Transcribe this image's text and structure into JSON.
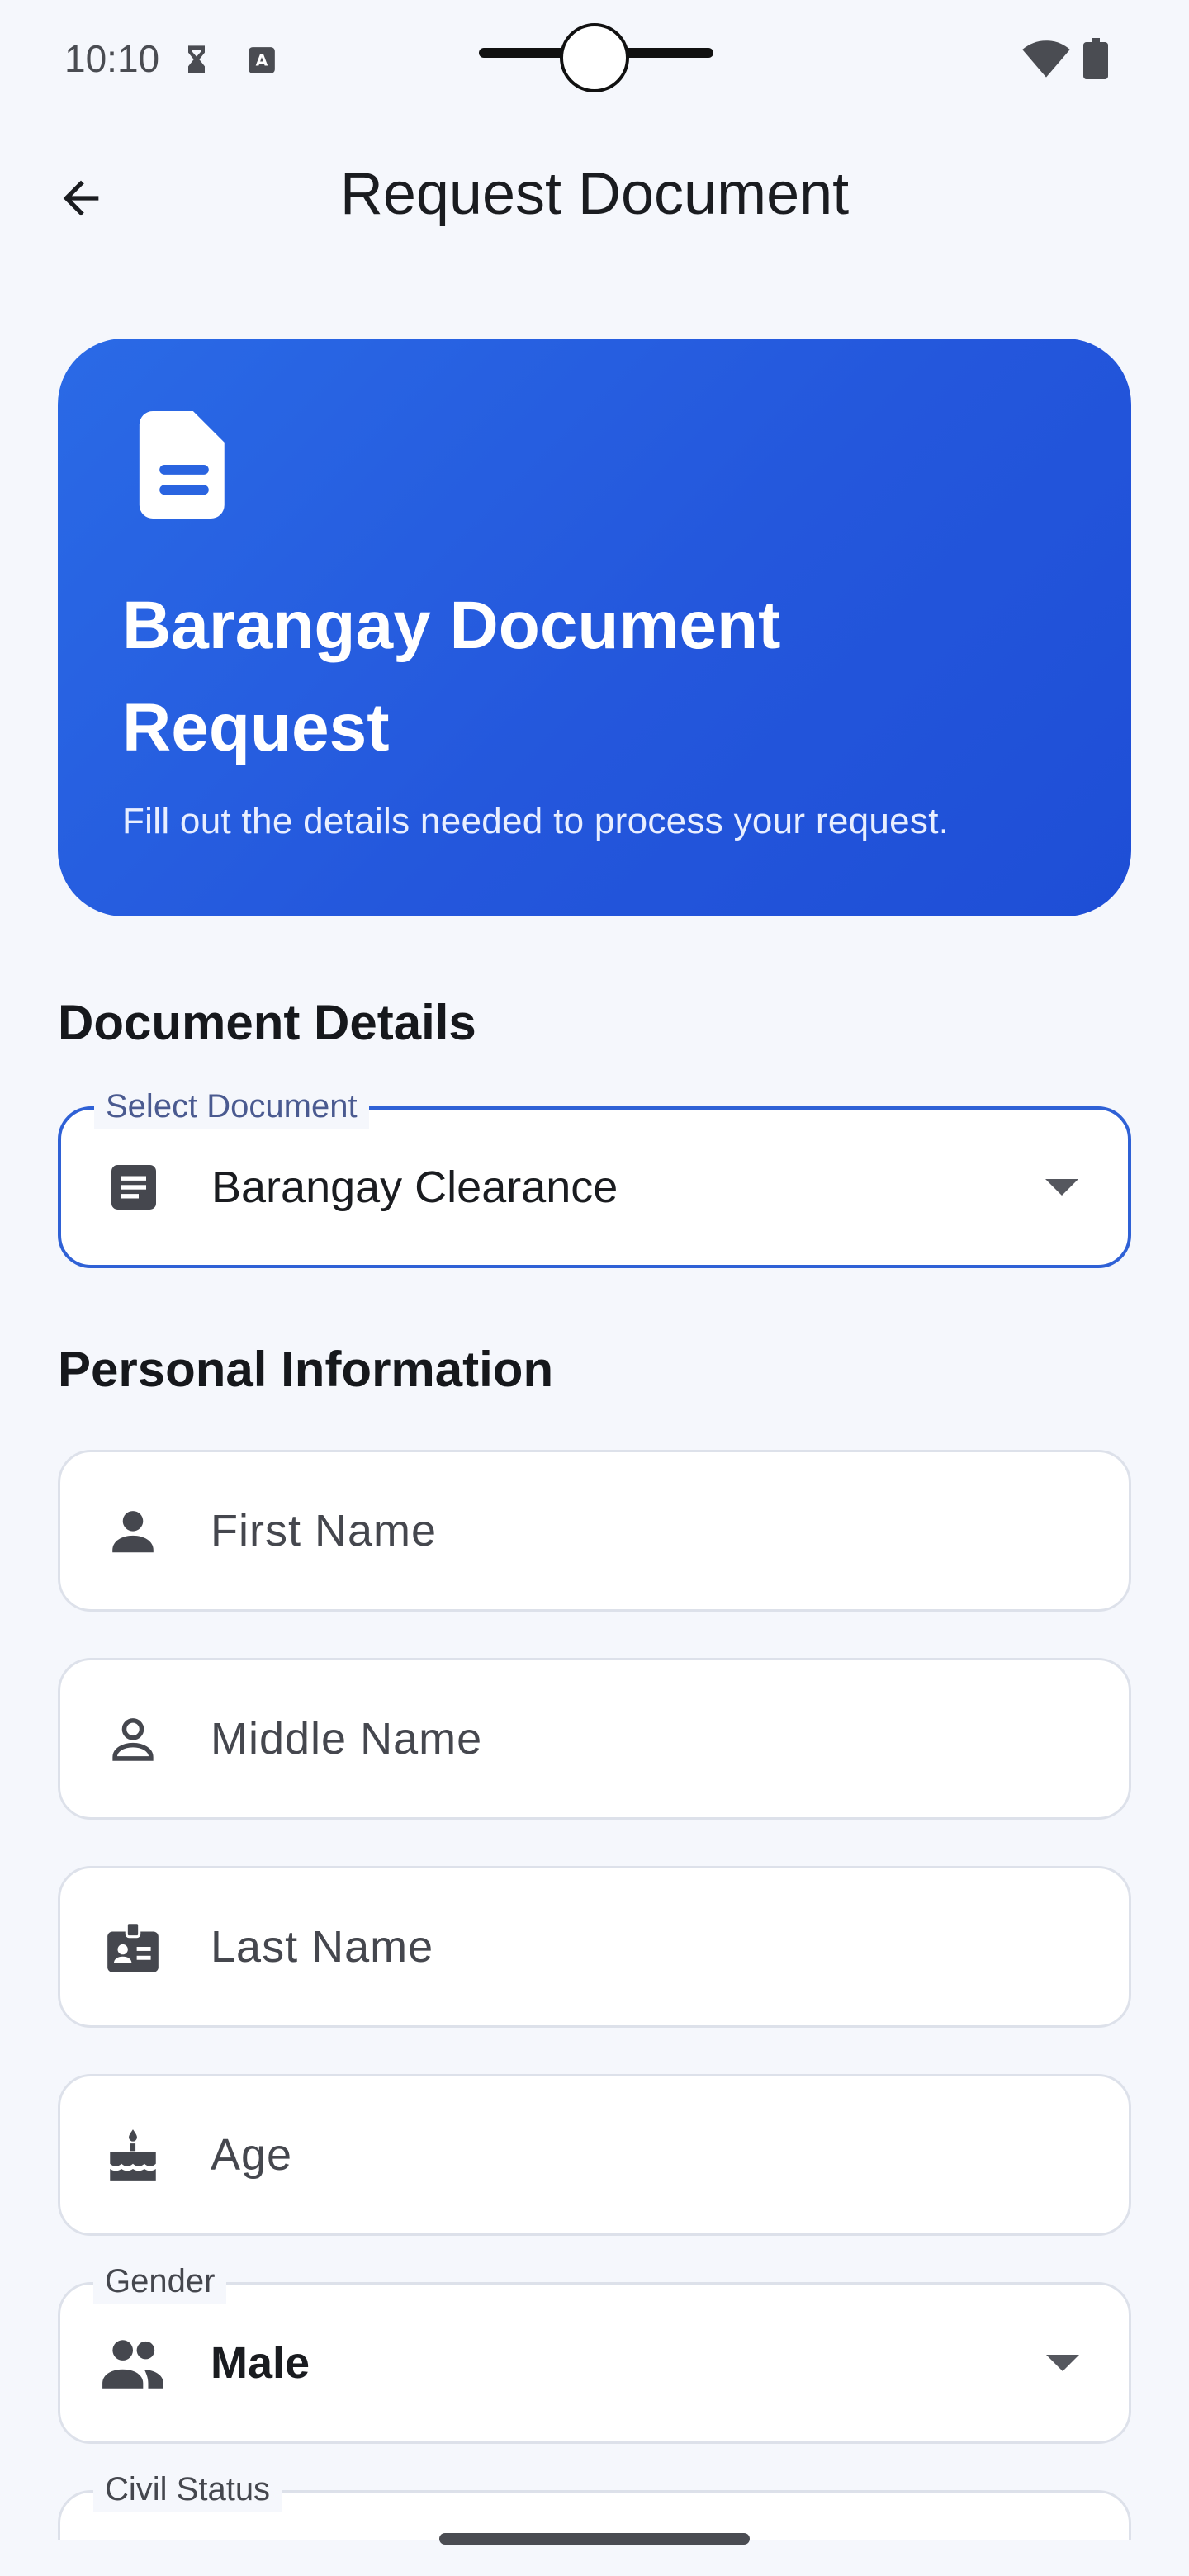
{
  "status_bar": {
    "time": "10:10",
    "icons": [
      "hourglass-icon",
      "keyboard-a-icon",
      "wifi-icon",
      "battery-icon"
    ]
  },
  "app_bar": {
    "title": "Request Document",
    "back_icon": "arrow-back-icon"
  },
  "hero": {
    "icon": "document-icon",
    "title": "Barangay Document Request",
    "subtitle": "Fill out the details needed to process your request.",
    "gradient_colors": [
      "#2a6ae6",
      "#1e4ed6"
    ]
  },
  "document_details": {
    "heading": "Document Details",
    "select_document": {
      "label": "Select Document",
      "value": "Barangay Clearance",
      "icon": "article-icon"
    }
  },
  "personal_information": {
    "heading": "Personal Information",
    "first_name": {
      "placeholder": "First Name",
      "icon": "person-icon"
    },
    "middle_name": {
      "placeholder": "Middle Name",
      "icon": "person-outline-icon"
    },
    "last_name": {
      "placeholder": "Last Name",
      "icon": "badge-icon"
    },
    "age": {
      "placeholder": "Age",
      "icon": "cake-icon"
    },
    "gender": {
      "label": "Gender",
      "value": "Male",
      "icon": "people-icon"
    },
    "civil_status": {
      "label": "Civil Status"
    }
  },
  "colors": {
    "accent": "#2f61d6",
    "background": "#f5f7fc",
    "field_border": "#dde1ea"
  }
}
